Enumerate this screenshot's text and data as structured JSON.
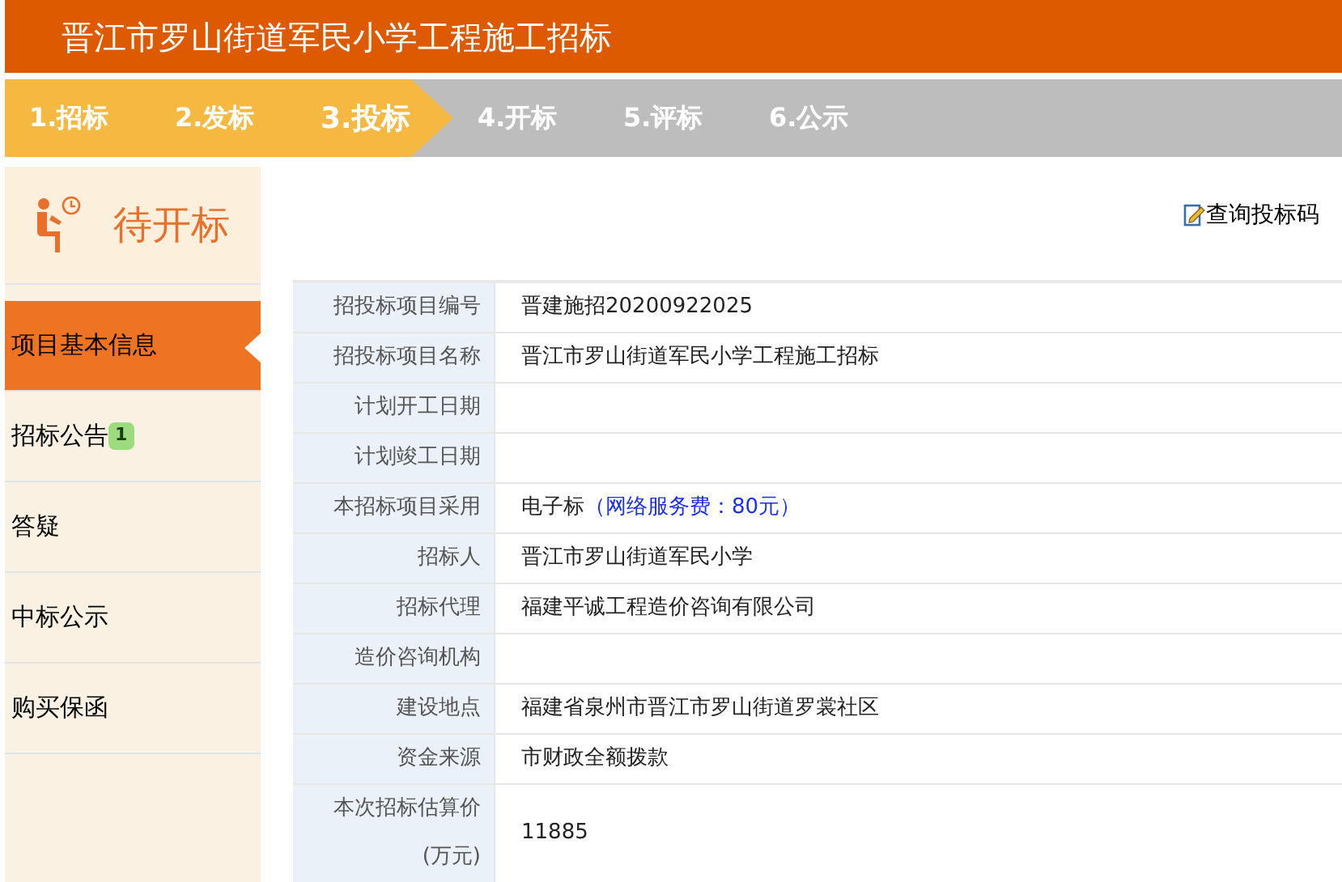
{
  "title": "晋江市罗山街道军民小学工程施工招标",
  "steps": [
    {
      "label": "1.招标",
      "done": true,
      "selected": false
    },
    {
      "label": "2.发标",
      "done": true,
      "selected": false
    },
    {
      "label": "3.投标",
      "done": true,
      "selected": true
    },
    {
      "label": "4.开标",
      "done": false,
      "selected": false
    },
    {
      "label": "5.评标",
      "done": false,
      "selected": false
    },
    {
      "label": "6.公示",
      "done": false,
      "selected": false
    }
  ],
  "status": "待开标",
  "menu": [
    {
      "label": "项目基本信息",
      "selected": true
    },
    {
      "label": "招标公告",
      "badge": "1",
      "selected": false
    },
    {
      "label": "答疑",
      "selected": false
    },
    {
      "label": "中标公示",
      "selected": false
    },
    {
      "label": "购买保函",
      "selected": false
    }
  ],
  "query_link": "查询投标码",
  "info_rows": [
    {
      "label": "招投标项目编号",
      "value": "晋建施招20200922025"
    },
    {
      "label": "招投标项目名称",
      "value": "晋江市罗山街道军民小学工程施工招标"
    },
    {
      "label": "计划开工日期"
    },
    {
      "label": "计划竣工日期"
    },
    {
      "label": "本招标项目采用",
      "value": "电子标",
      "note": "（网络服务费：80元）"
    },
    {
      "label": "招标人",
      "value": "晋江市罗山街道军民小学"
    },
    {
      "label": "招标代理",
      "value": "福建平诚工程造价咨询有限公司"
    },
    {
      "label": "造价咨询机构"
    },
    {
      "label": "建设地点",
      "value": "福建省泉州市晋江市罗山街道罗裳社区"
    },
    {
      "label": "资金来源",
      "value": "市财政全额拨款"
    },
    {
      "label": "本次招标估算价(万元)",
      "value": "11885"
    }
  ]
}
